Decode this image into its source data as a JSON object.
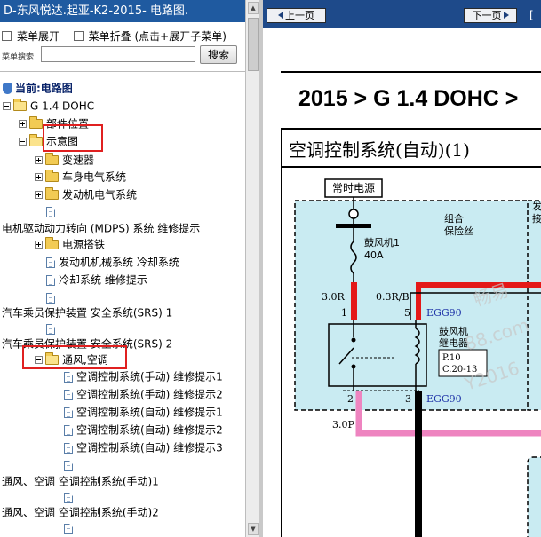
{
  "left_title": "D-东风悦达.起亚-K2-2015- 电路图.",
  "menu": {
    "expand_label": "菜单展开",
    "collapse_label": "菜单折叠 (点击+展开子菜单)"
  },
  "search": {
    "label": "菜单搜索",
    "placeholder": "",
    "button_label": "搜索"
  },
  "tree": {
    "current": "当前:电路图",
    "items": [
      "G 1.4 DOHC",
      "部件位置",
      "示意图",
      "变速器",
      "车身电气系统",
      "发动机电气系统",
      "",
      "电机驱动动力转向 (MDPS) 系统 维修提示",
      "电源搭铁",
      "发动机机械系统 冷却系统",
      "冷却系统 维修提示",
      "汽车乘员保护装置 安全系统(SRS) 1",
      "汽车乘员保护装置 安全系统(SRS) 2",
      "通风,空调",
      "空调控制系统(手动) 维修提示1",
      "空调控制系统(手动) 维修提示2",
      "空调控制系统(自动) 维修提示1",
      "空调控制系统(自动) 维修提示2",
      "空调控制系统(自动) 维修提示3",
      "通风、空调 空调控制系统(手动)1",
      "通风、空调 空调控制系统(手动)2"
    ]
  },
  "nav": {
    "prev_label": "上一页",
    "next_label": "下一页",
    "bracket": "["
  },
  "document": {
    "heading": "2015 > G 1.4 DOHC >",
    "section_title": "空调控制系统(自动)(1)",
    "diagram": {
      "power_label": "常时电源",
      "fuse_box_label_line1": "组合",
      "fuse_box_label_line2": "保险丝",
      "right_label_line1": "发",
      "right_label_line2": "接",
      "fuse_name": "鼓风机1",
      "fuse_rating": "40A",
      "wire_a": "3.0R",
      "wire_b": "0.3R/B",
      "pin_1": "1",
      "pin_5": "5",
      "pin_2": "2",
      "pin_3": "3",
      "connector_top": "EGG90",
      "connector_bottom": "EGG90",
      "relay_line1": "鼓风机",
      "relay_line2": "继电器",
      "relay_ref1": "P.10",
      "relay_ref2": "C.20-13",
      "wire_c": "3.0P"
    },
    "watermark": [
      "畅易",
      "88.com",
      "Y2016"
    ]
  },
  "colors": {
    "title_bar": "#1f5aa0",
    "right_bar": "#1e4a8a",
    "highlight": "#e02020",
    "fuse_box_fill": "#c9ebf2",
    "wire_red": "#e41818",
    "wire_pink": "#ee84c0",
    "connector_blue": "#1a2fa6"
  }
}
